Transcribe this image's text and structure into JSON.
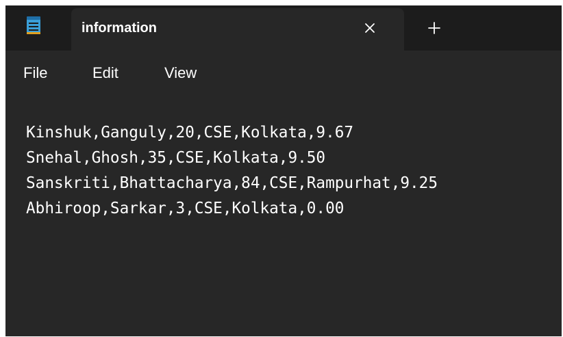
{
  "tab": {
    "title": "information",
    "close_icon": "close-icon",
    "new_tab_icon": "plus-icon"
  },
  "app_icon": "notepad-icon",
  "menu": {
    "file": "File",
    "edit": "Edit",
    "view": "View"
  },
  "editor": {
    "lines": [
      "Kinshuk,Ganguly,20,CSE,Kolkata,9.67",
      "Snehal,Ghosh,35,CSE,Kolkata,9.50",
      "Sanskriti,Bhattacharya,84,CSE,Rampurhat,9.25",
      "Abhiroop,Sarkar,3,CSE,Kolkata,0.00"
    ]
  },
  "colors": {
    "titlebar_bg": "#1c1c1c",
    "tab_bg": "#272727",
    "text": "#ffffff",
    "icon_accent": "#3a9fd8"
  }
}
